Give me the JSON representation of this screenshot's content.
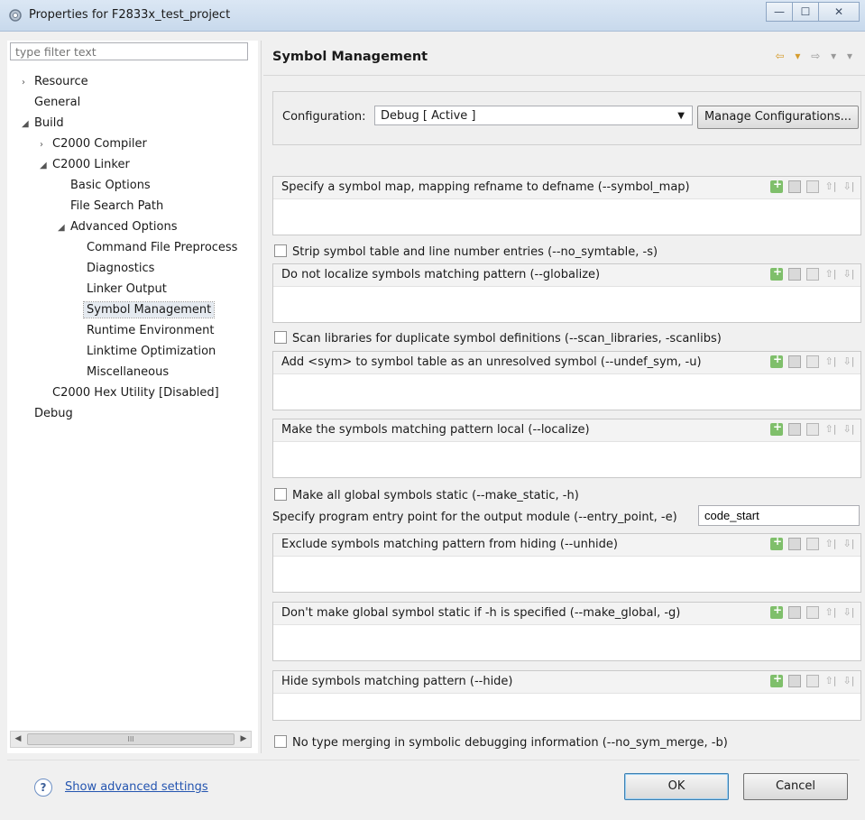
{
  "window": {
    "title": "Properties for F2833x_test_project",
    "minimize": "—",
    "maximize": "☐",
    "close": "✕"
  },
  "sidebar": {
    "filter_placeholder": "type filter text",
    "items": [
      {
        "label": "Resource",
        "arrow": "›"
      },
      {
        "label": "General",
        "arrow": ""
      },
      {
        "label": "Build",
        "arrow": "◢"
      },
      {
        "label": "C2000 Compiler",
        "arrow": "›"
      },
      {
        "label": "C2000 Linker",
        "arrow": "◢"
      },
      {
        "label": "Basic Options",
        "arrow": ""
      },
      {
        "label": "File Search Path",
        "arrow": ""
      },
      {
        "label": "Advanced Options",
        "arrow": "◢"
      },
      {
        "label": "Command File Preprocess",
        "arrow": ""
      },
      {
        "label": "Diagnostics",
        "arrow": ""
      },
      {
        "label": "Linker Output",
        "arrow": ""
      },
      {
        "label": "Symbol Management",
        "arrow": ""
      },
      {
        "label": "Runtime Environment",
        "arrow": ""
      },
      {
        "label": "Linktime Optimization",
        "arrow": ""
      },
      {
        "label": "Miscellaneous",
        "arrow": ""
      },
      {
        "label": "C2000 Hex Utility  [Disabled]",
        "arrow": ""
      },
      {
        "label": "Debug",
        "arrow": ""
      }
    ],
    "scroll_left": "◀",
    "scroll_right": "▶",
    "scroll_thumb": "III"
  },
  "main": {
    "page_title": "Symbol Management",
    "nav_back": "⇦ ▾",
    "nav_fwd": "⇨ ▾ ▾",
    "configuration_label": "Configuration:",
    "configuration_value": "Debug  [ Active ]",
    "dropdown_arrow": "▼",
    "manage_button": "Manage Configurations...",
    "lists": {
      "symbol_map": "Specify a symbol map, mapping refname to defname (--symbol_map)",
      "globalize": "Do not localize symbols matching pattern (--globalize)",
      "undef_sym": "Add <sym> to symbol table as an unresolved symbol (--undef_sym, -u)",
      "localize": "Make the symbols matching pattern local (--localize)",
      "unhide": "Exclude symbols matching pattern from hiding (--unhide)",
      "make_global": "Don't make global symbol static if -h is specified (--make_global, -g)",
      "hide": "Hide symbols matching pattern (--hide)"
    },
    "checks": {
      "no_symtable": "Strip symbol table and line number entries (--no_symtable, -s)",
      "scan_libraries": "Scan libraries for duplicate symbol definitions (--scan_libraries, -scanlibs)",
      "make_static": "Make all global symbols static (--make_static, -h)",
      "no_sym_merge": "No type merging in symbolic debugging information (--no_sym_merge, -b)"
    },
    "entry_point_label": "Specify program entry point for the output module (--entry_point, -e)",
    "entry_point_value": "code_start",
    "tool_up": "⇧|",
    "tool_down": "⇩|"
  },
  "footer": {
    "help": "?",
    "advanced_link": "Show advanced settings",
    "ok": "OK",
    "cancel": "Cancel"
  }
}
